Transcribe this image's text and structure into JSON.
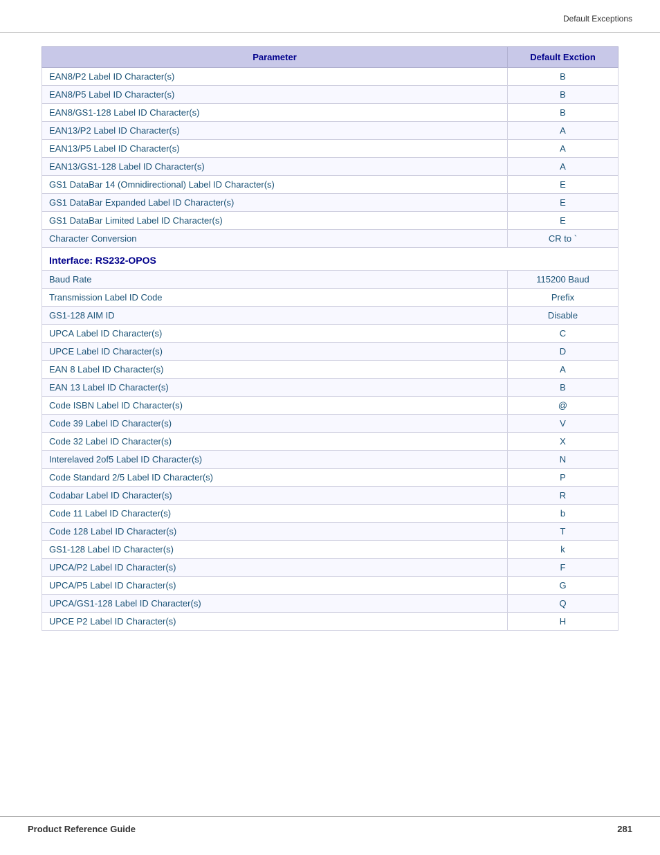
{
  "header": {
    "text": "Default Exceptions"
  },
  "table": {
    "col1_header": "Parameter",
    "col2_header": "Default Exction",
    "rows_before_section": [
      {
        "param": "EAN8/P2 Label ID Character(s)",
        "value": "B"
      },
      {
        "param": "EAN8/P5 Label ID Character(s)",
        "value": "B"
      },
      {
        "param": "EAN8/GS1-128 Label ID Character(s)",
        "value": "B"
      },
      {
        "param": "EAN13/P2 Label ID Character(s)",
        "value": "A"
      },
      {
        "param": "EAN13/P5 Label ID Character(s)",
        "value": "A"
      },
      {
        "param": "EAN13/GS1-128 Label ID Character(s)",
        "value": "A"
      },
      {
        "param": "GS1 DataBar 14 (Omnidirectional) Label ID Character(s)",
        "value": "E"
      },
      {
        "param": "GS1 DataBar Expanded Label ID Character(s)",
        "value": "E"
      },
      {
        "param": "GS1 DataBar Limited Label ID Character(s)",
        "value": "E"
      },
      {
        "param": "Character Conversion",
        "value": "CR to `"
      }
    ],
    "section_header": "Interface: RS232-OPOS",
    "rows_after_section": [
      {
        "param": "Baud Rate",
        "value": "115200 Baud"
      },
      {
        "param": "Transmission Label ID Code",
        "value": "Prefix"
      },
      {
        "param": "GS1-128 AIM ID",
        "value": "Disable"
      },
      {
        "param": "UPCA Label ID Character(s)",
        "value": "C"
      },
      {
        "param": "UPCE Label ID Character(s)",
        "value": "D"
      },
      {
        "param": "EAN 8 Label ID Character(s)",
        "value": "A"
      },
      {
        "param": "EAN 13 Label ID Character(s)",
        "value": "B"
      },
      {
        "param": "Code ISBN Label ID Character(s)",
        "value": "@"
      },
      {
        "param": "Code 39 Label ID Character(s)",
        "value": "V"
      },
      {
        "param": "Code 32 Label ID Character(s)",
        "value": "X"
      },
      {
        "param": "Interelaved 2of5 Label ID Character(s)",
        "value": "N"
      },
      {
        "param": "Code Standard 2/5 Label ID Character(s)",
        "value": "P"
      },
      {
        "param": "Codabar Label ID Character(s)",
        "value": "R"
      },
      {
        "param": "Code 11 Label ID Character(s)",
        "value": "b"
      },
      {
        "param": "Code 128 Label ID Character(s)",
        "value": "T"
      },
      {
        "param": "GS1-128 Label ID Character(s)",
        "value": "k"
      },
      {
        "param": "UPCA/P2 Label ID Character(s)",
        "value": "F"
      },
      {
        "param": "UPCA/P5 Label ID Character(s)",
        "value": "G"
      },
      {
        "param": "UPCA/GS1-128 Label ID Character(s)",
        "value": "Q"
      },
      {
        "param": "UPCE P2 Label ID Character(s)",
        "value": "H"
      }
    ]
  },
  "footer": {
    "left": "Product Reference Guide",
    "right": "281"
  }
}
